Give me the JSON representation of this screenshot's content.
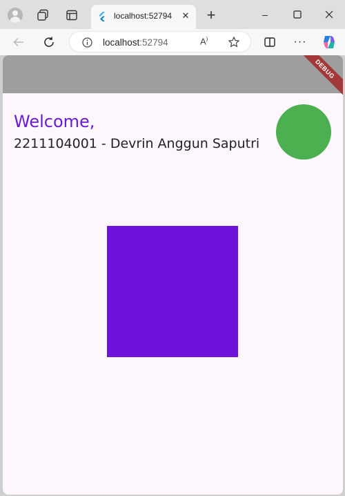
{
  "browser": {
    "tab": {
      "title": "localhost:52794"
    },
    "address": {
      "host": "localhost",
      "port": ":52794"
    },
    "icons": {
      "profile": "profile-icon",
      "collections": "collections-icon",
      "tab_actions": "tab-actions-icon",
      "favicon": "flutter-icon",
      "close_tab": "close-icon",
      "new_tab": "plus-icon",
      "back": "back-arrow-icon",
      "reload": "reload-icon",
      "site_info": "info-icon",
      "read_aloud": "read-aloud-icon",
      "favorite": "star-icon",
      "split_screen": "split-screen-icon",
      "more": "more-icon",
      "copilot": "copilot-icon"
    },
    "window_controls": {
      "minimize": "–",
      "maximize": "☐",
      "close": "✕"
    }
  },
  "app": {
    "debug_banner": "DEBUG",
    "welcome": "Welcome,",
    "student_line": "2211104001 - Devrin Anggun Saputri",
    "colors": {
      "appbar": "#9e9e9e",
      "background": "#fdf6fd",
      "welcome_text": "#6a1bd1",
      "avatar": "#4caf50",
      "square": "#7013da",
      "debug_banner": "#a23838"
    }
  }
}
